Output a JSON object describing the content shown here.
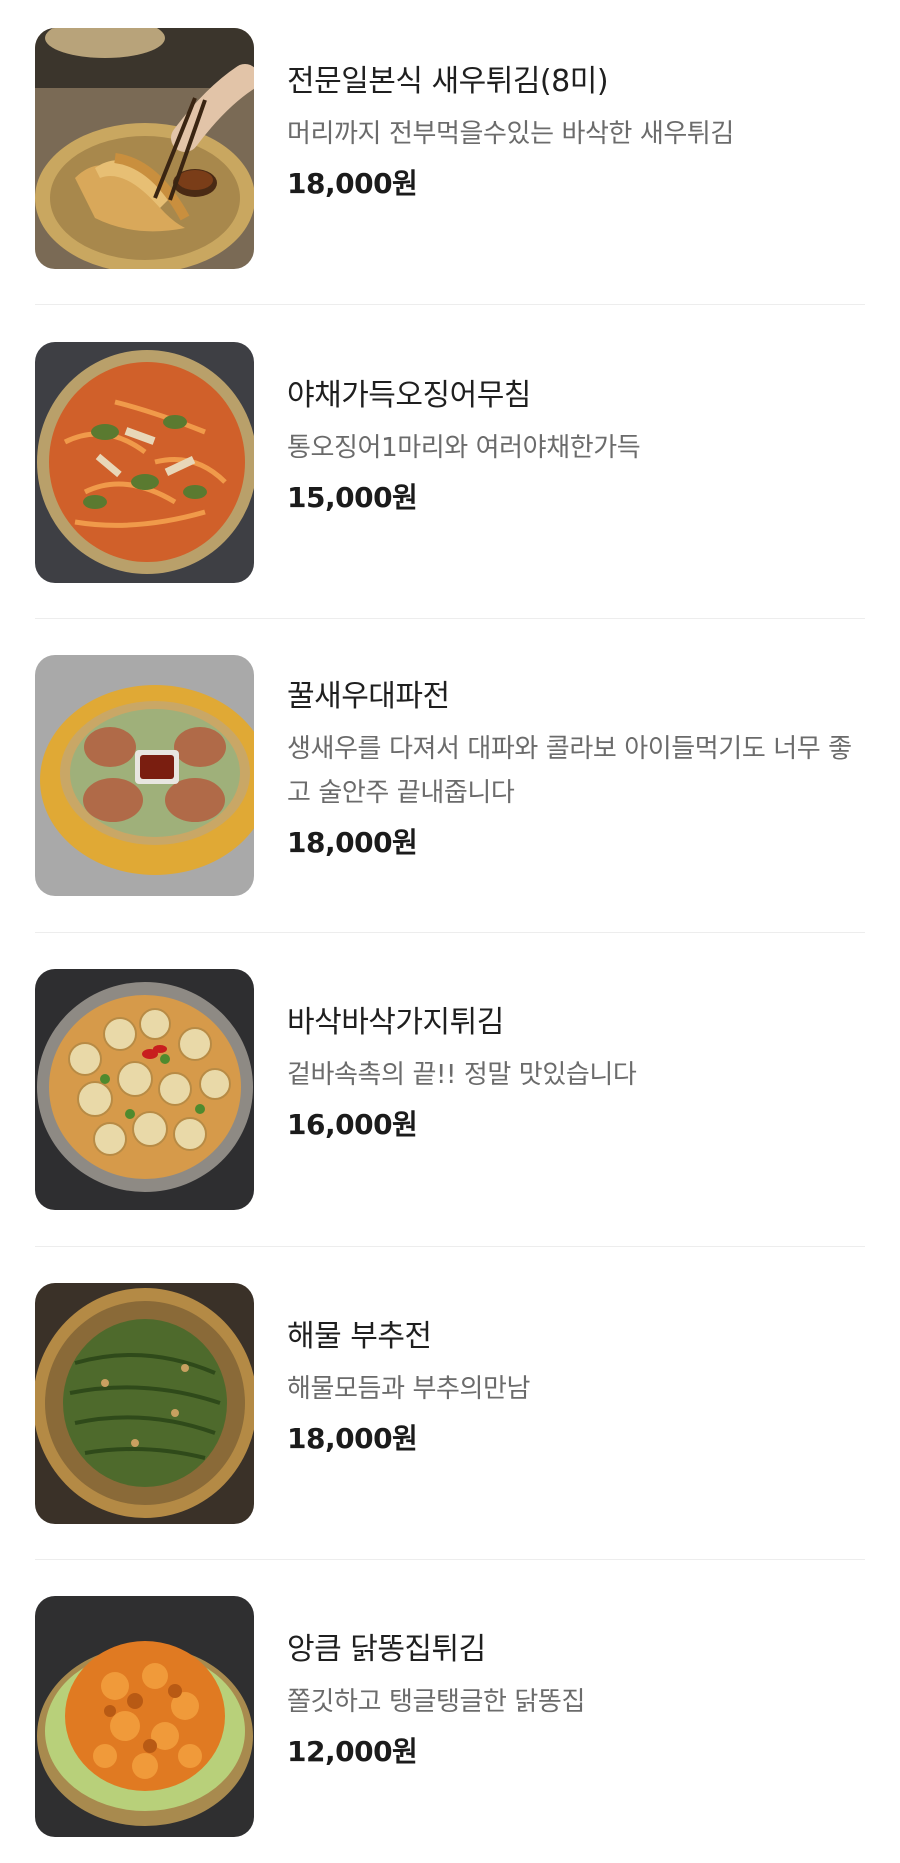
{
  "menu": {
    "items": [
      {
        "name": "전문일본식 새우튀김(8미)",
        "description": "머리까지 전부먹을수있는 바삭한 새우튀김",
        "price": "18,000원",
        "image_icon": "shrimp-tempura-photo"
      },
      {
        "name": "야채가득오징어무침",
        "description": "통오징어1마리와 여러야채한가득",
        "price": "15,000원",
        "image_icon": "squid-salad-photo"
      },
      {
        "name": "꿀새우대파전",
        "description": "생새우를 다져서 대파와 콜라보 아이들먹기도 너무 좋고 술안주 끝내줍니다",
        "price": "18,000원",
        "image_icon": "shrimp-pancake-photo"
      },
      {
        "name": "바삭바삭가지튀김",
        "description": "겉바속촉의 끝!! 정말 맛있습니다",
        "price": "16,000원",
        "image_icon": "eggplant-fry-photo"
      },
      {
        "name": "해물 부추전",
        "description": "해물모듬과 부추의만남",
        "price": "18,000원",
        "image_icon": "seafood-chive-pancake-photo"
      },
      {
        "name": "앙큼 닭똥집튀김",
        "description": "쫄깃하고 탱글탱글한 닭똥집",
        "price": "12,000원",
        "image_icon": "fried-gizzard-photo"
      }
    ]
  }
}
